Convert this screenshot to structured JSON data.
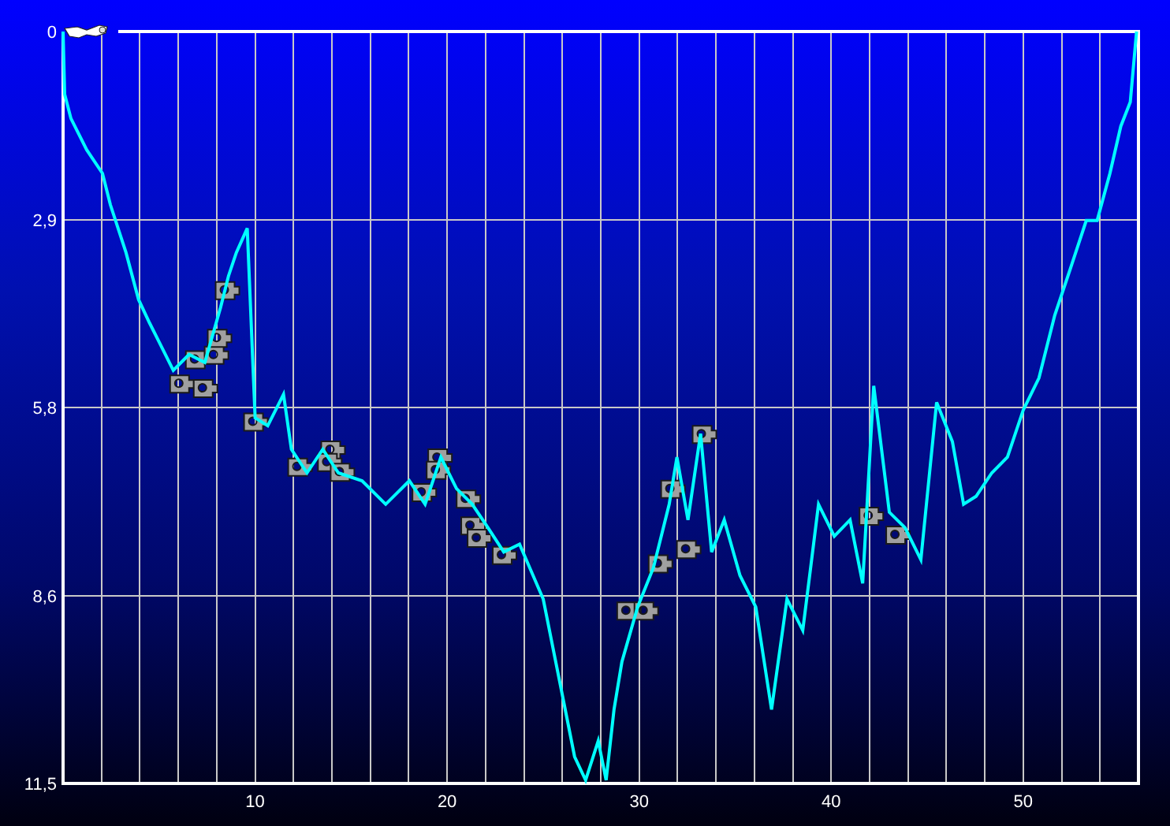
{
  "chart_data": {
    "type": "line",
    "xlim": [
      0,
      56
    ],
    "ylim": [
      11.5,
      0
    ],
    "grid": true,
    "xticks": [
      10,
      20,
      30,
      40,
      50
    ],
    "yticks": [
      {
        "value": 0,
        "label": "0"
      },
      {
        "value": 2.875,
        "label": "2,9"
      },
      {
        "value": 5.75,
        "label": "5,8"
      },
      {
        "value": 8.625,
        "label": "8,6"
      },
      {
        "value": 11.5,
        "label": "11,5"
      }
    ],
    "x": [
      0,
      0.08,
      0.41,
      1.23,
      2.05,
      2.46,
      3.28,
      3.93,
      4.51,
      4.92,
      5.74,
      6.56,
      7.38,
      8.2,
      8.61,
      9.02,
      9.59,
      10,
      10.66,
      11.48,
      11.89,
      12.7,
      13.52,
      14.34,
      15.57,
      16.8,
      18.03,
      18.85,
      19.67,
      20.49,
      21.31,
      22.13,
      22.95,
      23.77,
      25,
      25.82,
      26.64,
      27.21,
      27.87,
      28.28,
      28.69,
      29.1,
      29.92,
      30.74,
      31.56,
      31.97,
      32.54,
      33.2,
      33.77,
      34.43,
      35.25,
      36.07,
      36.89,
      37.7,
      38.52,
      38.93,
      39.34,
      40.16,
      40.98,
      41.64,
      42.21,
      43.03,
      43.85,
      44.67,
      45.49,
      46.31,
      46.89,
      47.54,
      48.36,
      49.18,
      50,
      50.82,
      51.64,
      52.46,
      53.28,
      53.85,
      54.51,
      55.08,
      55.57,
      55.9
    ],
    "series": [
      {
        "color": "#00ffff",
        "values": [
          0,
          0.96,
          1.33,
          1.81,
          2.17,
          2.65,
          3.38,
          4.1,
          4.46,
          4.7,
          5.18,
          4.94,
          5.06,
          4.22,
          3.74,
          3.38,
          3.01,
          5.91,
          6.03,
          5.55,
          6.39,
          6.75,
          6.39,
          6.75,
          6.87,
          7.23,
          6.87,
          7.23,
          6.51,
          6.99,
          7.23,
          7.59,
          7.96,
          7.84,
          8.68,
          9.89,
          11.09,
          11.45,
          10.85,
          11.45,
          10.37,
          9.64,
          8.8,
          8.2,
          7.23,
          6.51,
          7.47,
          6.15,
          7.96,
          7.47,
          8.32,
          8.8,
          10.37,
          8.68,
          9.16,
          8.2,
          7.23,
          7.72,
          7.47,
          8.44,
          5.42,
          7.35,
          7.59,
          8.08,
          5.67,
          6.27,
          7.23,
          7.11,
          6.75,
          6.51,
          5.79,
          5.3,
          4.34,
          3.62,
          2.89,
          2.89,
          2.17,
          1.45,
          1.08,
          0
        ]
      },
      {
        "type": "scatter",
        "color": "#a0a0a0",
        "x": [
          6.15,
          6.97,
          7.38,
          7.95,
          8.11,
          8.52,
          10,
          12.3,
          14.02,
          13.85,
          14.51,
          18.77,
          19.59,
          19.51,
          21.07,
          21.31,
          21.64,
          22.95,
          29.43,
          30.33,
          31.07,
          31.72,
          32.54,
          33.36,
          42.05,
          43.44
        ],
        "values": [
          5.38,
          5.01,
          5.45,
          4.94,
          4.68,
          3.95,
          5.96,
          6.65,
          6.39,
          6.58,
          6.73,
          7.04,
          6.51,
          6.7,
          7.14,
          7.55,
          7.74,
          8.0,
          8.85,
          8.85,
          8.13,
          6.99,
          7.91,
          6.15,
          7.4,
          7.69
        ]
      }
    ]
  }
}
